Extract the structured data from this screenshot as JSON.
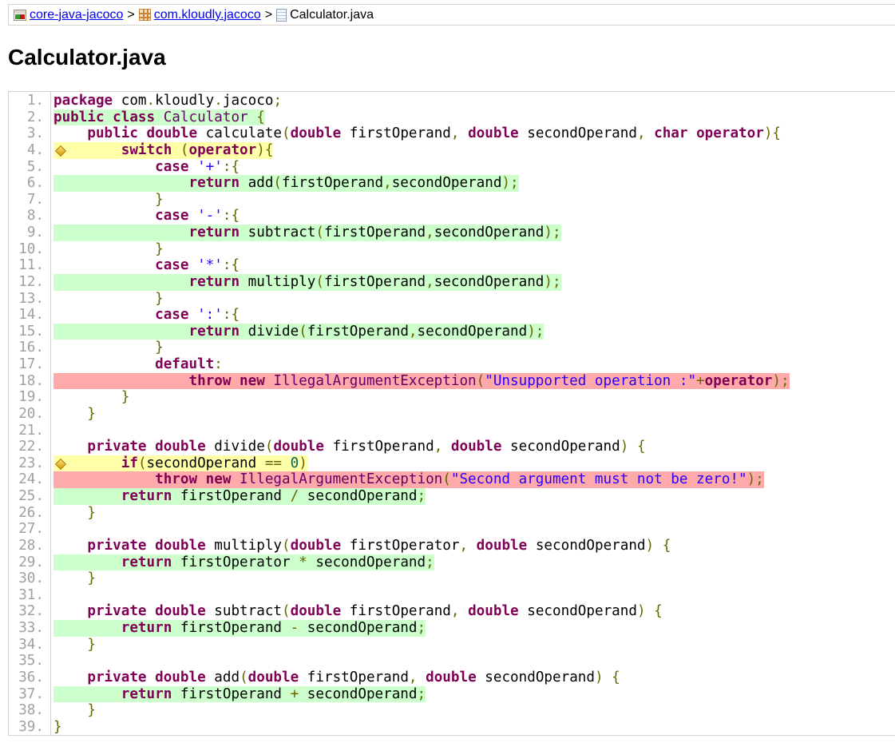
{
  "breadcrumb": {
    "items": [
      {
        "label": "core-java-jacoco",
        "icon": "report-icon"
      },
      {
        "label": "com.kloudly.jacoco",
        "icon": "package-icon"
      }
    ],
    "current": {
      "label": "Calculator.java",
      "icon": "source-file-icon"
    },
    "separator": ">"
  },
  "title": "Calculator.java",
  "colors": {
    "covered": "#ccffcc",
    "not_covered": "#ffaaaa",
    "partial": "#ffffaa",
    "keyword": "#7f0055",
    "string": "#2a00ff"
  },
  "source": [
    {
      "n": "1.",
      "cov": "",
      "tokens": [
        [
          "k",
          "package"
        ],
        [
          "t",
          " com"
        ],
        [
          "p",
          "."
        ],
        [
          "t",
          "kloudly"
        ],
        [
          "p",
          "."
        ],
        [
          "t",
          "jacoco"
        ],
        [
          "p",
          ";"
        ]
      ]
    },
    {
      "n": "2.",
      "cov": "fc",
      "tokens": [
        [
          "k",
          "public"
        ],
        [
          "t",
          " "
        ],
        [
          "k",
          "class"
        ],
        [
          "t",
          " "
        ],
        [
          "y",
          "Calculator"
        ],
        [
          "t",
          " "
        ],
        [
          "p",
          "{"
        ]
      ]
    },
    {
      "n": "3.",
      "cov": "",
      "tokens": [
        [
          "t",
          "    "
        ],
        [
          "k",
          "public"
        ],
        [
          "t",
          " "
        ],
        [
          "k",
          "double"
        ],
        [
          "t",
          " calculate"
        ],
        [
          "p",
          "("
        ],
        [
          "k",
          "double"
        ],
        [
          "t",
          " firstOperand"
        ],
        [
          "p",
          ","
        ],
        [
          "t",
          " "
        ],
        [
          "k",
          "double"
        ],
        [
          "t",
          " secondOperand"
        ],
        [
          "p",
          ","
        ],
        [
          "t",
          " "
        ],
        [
          "k",
          "char"
        ],
        [
          "t",
          " "
        ],
        [
          "k",
          "operator"
        ],
        [
          "p",
          "){"
        ]
      ]
    },
    {
      "n": "4.",
      "cov": "pc",
      "tokens": [
        [
          "t",
          "        "
        ],
        [
          "k",
          "switch"
        ],
        [
          "t",
          " "
        ],
        [
          "p",
          "("
        ],
        [
          "k",
          "operator"
        ],
        [
          "p",
          "){"
        ]
      ]
    },
    {
      "n": "5.",
      "cov": "",
      "tokens": [
        [
          "t",
          "            "
        ],
        [
          "k",
          "case"
        ],
        [
          "t",
          " "
        ],
        [
          "s",
          "'+'"
        ],
        [
          "p",
          ":{"
        ]
      ]
    },
    {
      "n": "6.",
      "cov": "fc",
      "tokens": [
        [
          "t",
          "                "
        ],
        [
          "k",
          "return"
        ],
        [
          "t",
          " add"
        ],
        [
          "p",
          "("
        ],
        [
          "t",
          "firstOperand"
        ],
        [
          "p",
          ","
        ],
        [
          "t",
          "secondOperand"
        ],
        [
          "p",
          ");"
        ]
      ]
    },
    {
      "n": "7.",
      "cov": "",
      "tokens": [
        [
          "t",
          "            "
        ],
        [
          "p",
          "}"
        ]
      ]
    },
    {
      "n": "8.",
      "cov": "",
      "tokens": [
        [
          "t",
          "            "
        ],
        [
          "k",
          "case"
        ],
        [
          "t",
          " "
        ],
        [
          "s",
          "'-'"
        ],
        [
          "p",
          ":{"
        ]
      ]
    },
    {
      "n": "9.",
      "cov": "fc",
      "tokens": [
        [
          "t",
          "                "
        ],
        [
          "k",
          "return"
        ],
        [
          "t",
          " subtract"
        ],
        [
          "p",
          "("
        ],
        [
          "t",
          "firstOperand"
        ],
        [
          "p",
          ","
        ],
        [
          "t",
          "secondOperand"
        ],
        [
          "p",
          ");"
        ]
      ]
    },
    {
      "n": "10.",
      "cov": "",
      "tokens": [
        [
          "t",
          "            "
        ],
        [
          "p",
          "}"
        ]
      ]
    },
    {
      "n": "11.",
      "cov": "",
      "tokens": [
        [
          "t",
          "            "
        ],
        [
          "k",
          "case"
        ],
        [
          "t",
          " "
        ],
        [
          "s",
          "'*'"
        ],
        [
          "p",
          ":{"
        ]
      ]
    },
    {
      "n": "12.",
      "cov": "fc",
      "tokens": [
        [
          "t",
          "                "
        ],
        [
          "k",
          "return"
        ],
        [
          "t",
          " multiply"
        ],
        [
          "p",
          "("
        ],
        [
          "t",
          "firstOperand"
        ],
        [
          "p",
          ","
        ],
        [
          "t",
          "secondOperand"
        ],
        [
          "p",
          ");"
        ]
      ]
    },
    {
      "n": "13.",
      "cov": "",
      "tokens": [
        [
          "t",
          "            "
        ],
        [
          "p",
          "}"
        ]
      ]
    },
    {
      "n": "14.",
      "cov": "",
      "tokens": [
        [
          "t",
          "            "
        ],
        [
          "k",
          "case"
        ],
        [
          "t",
          " "
        ],
        [
          "s",
          "':'"
        ],
        [
          "p",
          ":{"
        ]
      ]
    },
    {
      "n": "15.",
      "cov": "fc",
      "tokens": [
        [
          "t",
          "                "
        ],
        [
          "k",
          "return"
        ],
        [
          "t",
          " divide"
        ],
        [
          "p",
          "("
        ],
        [
          "t",
          "firstOperand"
        ],
        [
          "p",
          ","
        ],
        [
          "t",
          "secondOperand"
        ],
        [
          "p",
          ");"
        ]
      ]
    },
    {
      "n": "16.",
      "cov": "",
      "tokens": [
        [
          "t",
          "            "
        ],
        [
          "p",
          "}"
        ]
      ]
    },
    {
      "n": "17.",
      "cov": "",
      "tokens": [
        [
          "t",
          "            "
        ],
        [
          "k",
          "default"
        ],
        [
          "p",
          ":"
        ]
      ]
    },
    {
      "n": "18.",
      "cov": "nc",
      "tokens": [
        [
          "t",
          "                "
        ],
        [
          "k",
          "throw"
        ],
        [
          "t",
          " "
        ],
        [
          "k",
          "new"
        ],
        [
          "t",
          " "
        ],
        [
          "y",
          "IllegalArgumentException"
        ],
        [
          "p",
          "("
        ],
        [
          "s",
          "\"Unsupported operation :\""
        ],
        [
          "p",
          "+"
        ],
        [
          "k",
          "operator"
        ],
        [
          "p",
          ");"
        ]
      ]
    },
    {
      "n": "19.",
      "cov": "",
      "tokens": [
        [
          "t",
          "        "
        ],
        [
          "p",
          "}"
        ]
      ]
    },
    {
      "n": "20.",
      "cov": "",
      "tokens": [
        [
          "t",
          "    "
        ],
        [
          "p",
          "}"
        ]
      ]
    },
    {
      "n": "21.",
      "cov": "",
      "tokens": []
    },
    {
      "n": "22.",
      "cov": "",
      "tokens": [
        [
          "t",
          "    "
        ],
        [
          "k",
          "private"
        ],
        [
          "t",
          " "
        ],
        [
          "k",
          "double"
        ],
        [
          "t",
          " divide"
        ],
        [
          "p",
          "("
        ],
        [
          "k",
          "double"
        ],
        [
          "t",
          " firstOperand"
        ],
        [
          "p",
          ","
        ],
        [
          "t",
          " "
        ],
        [
          "k",
          "double"
        ],
        [
          "t",
          " secondOperand"
        ],
        [
          "p",
          ")"
        ],
        [
          "t",
          " "
        ],
        [
          "p",
          "{"
        ]
      ]
    },
    {
      "n": "23.",
      "cov": "pc",
      "tokens": [
        [
          "t",
          "        "
        ],
        [
          "k",
          "if"
        ],
        [
          "p",
          "("
        ],
        [
          "t",
          "secondOperand "
        ],
        [
          "p",
          "=="
        ],
        [
          "t",
          " "
        ],
        [
          "n",
          "0"
        ],
        [
          "p",
          ")"
        ]
      ]
    },
    {
      "n": "24.",
      "cov": "nc",
      "tokens": [
        [
          "t",
          "            "
        ],
        [
          "k",
          "throw"
        ],
        [
          "t",
          " "
        ],
        [
          "k",
          "new"
        ],
        [
          "t",
          " "
        ],
        [
          "y",
          "IllegalArgumentException"
        ],
        [
          "p",
          "("
        ],
        [
          "s",
          "\"Second argument must not be zero!\""
        ],
        [
          "p",
          ");"
        ]
      ]
    },
    {
      "n": "25.",
      "cov": "fc",
      "tokens": [
        [
          "t",
          "        "
        ],
        [
          "k",
          "return"
        ],
        [
          "t",
          " firstOperand "
        ],
        [
          "p",
          "/"
        ],
        [
          "t",
          " secondOperand"
        ],
        [
          "p",
          ";"
        ]
      ]
    },
    {
      "n": "26.",
      "cov": "",
      "tokens": [
        [
          "t",
          "    "
        ],
        [
          "p",
          "}"
        ]
      ]
    },
    {
      "n": "27.",
      "cov": "",
      "tokens": []
    },
    {
      "n": "28.",
      "cov": "",
      "tokens": [
        [
          "t",
          "    "
        ],
        [
          "k",
          "private"
        ],
        [
          "t",
          " "
        ],
        [
          "k",
          "double"
        ],
        [
          "t",
          " multiply"
        ],
        [
          "p",
          "("
        ],
        [
          "k",
          "double"
        ],
        [
          "t",
          " firstOperator"
        ],
        [
          "p",
          ","
        ],
        [
          "t",
          " "
        ],
        [
          "k",
          "double"
        ],
        [
          "t",
          " secondOperand"
        ],
        [
          "p",
          ")"
        ],
        [
          "t",
          " "
        ],
        [
          "p",
          "{"
        ]
      ]
    },
    {
      "n": "29.",
      "cov": "fc",
      "tokens": [
        [
          "t",
          "        "
        ],
        [
          "k",
          "return"
        ],
        [
          "t",
          " firstOperator "
        ],
        [
          "p",
          "*"
        ],
        [
          "t",
          " secondOperand"
        ],
        [
          "p",
          ";"
        ]
      ]
    },
    {
      "n": "30.",
      "cov": "",
      "tokens": [
        [
          "t",
          "    "
        ],
        [
          "p",
          "}"
        ]
      ]
    },
    {
      "n": "31.",
      "cov": "",
      "tokens": []
    },
    {
      "n": "32.",
      "cov": "",
      "tokens": [
        [
          "t",
          "    "
        ],
        [
          "k",
          "private"
        ],
        [
          "t",
          " "
        ],
        [
          "k",
          "double"
        ],
        [
          "t",
          " subtract"
        ],
        [
          "p",
          "("
        ],
        [
          "k",
          "double"
        ],
        [
          "t",
          " firstOperand"
        ],
        [
          "p",
          ","
        ],
        [
          "t",
          " "
        ],
        [
          "k",
          "double"
        ],
        [
          "t",
          " secondOperand"
        ],
        [
          "p",
          ")"
        ],
        [
          "t",
          " "
        ],
        [
          "p",
          "{"
        ]
      ]
    },
    {
      "n": "33.",
      "cov": "fc",
      "tokens": [
        [
          "t",
          "        "
        ],
        [
          "k",
          "return"
        ],
        [
          "t",
          " firstOperand "
        ],
        [
          "p",
          "-"
        ],
        [
          "t",
          " secondOperand"
        ],
        [
          "p",
          ";"
        ]
      ]
    },
    {
      "n": "34.",
      "cov": "",
      "tokens": [
        [
          "t",
          "    "
        ],
        [
          "p",
          "}"
        ]
      ]
    },
    {
      "n": "35.",
      "cov": "",
      "tokens": []
    },
    {
      "n": "36.",
      "cov": "",
      "tokens": [
        [
          "t",
          "    "
        ],
        [
          "k",
          "private"
        ],
        [
          "t",
          " "
        ],
        [
          "k",
          "double"
        ],
        [
          "t",
          " add"
        ],
        [
          "p",
          "("
        ],
        [
          "k",
          "double"
        ],
        [
          "t",
          " firstOperand"
        ],
        [
          "p",
          ","
        ],
        [
          "t",
          " "
        ],
        [
          "k",
          "double"
        ],
        [
          "t",
          " secondOperand"
        ],
        [
          "p",
          ")"
        ],
        [
          "t",
          " "
        ],
        [
          "p",
          "{"
        ]
      ]
    },
    {
      "n": "37.",
      "cov": "fc",
      "tokens": [
        [
          "t",
          "        "
        ],
        [
          "k",
          "return"
        ],
        [
          "t",
          " firstOperand "
        ],
        [
          "p",
          "+"
        ],
        [
          "t",
          " secondOperand"
        ],
        [
          "p",
          ";"
        ]
      ]
    },
    {
      "n": "38.",
      "cov": "",
      "tokens": [
        [
          "t",
          "    "
        ],
        [
          "p",
          "}"
        ]
      ]
    },
    {
      "n": "39.",
      "cov": "",
      "tokens": [
        [
          "p",
          "}"
        ]
      ]
    }
  ]
}
